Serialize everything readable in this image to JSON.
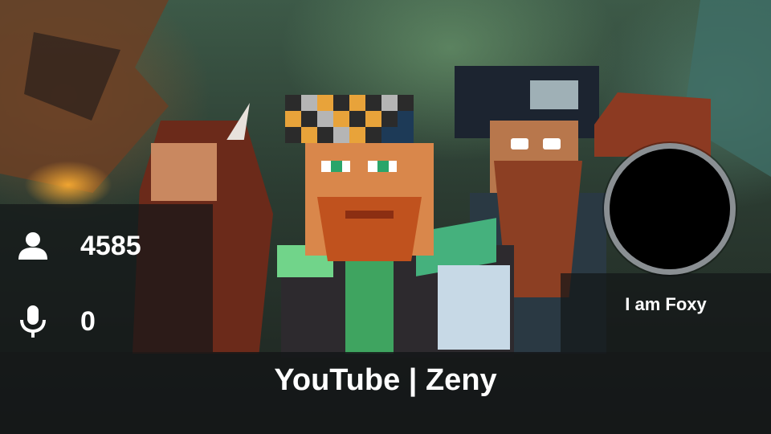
{
  "stats": {
    "viewers": {
      "icon": "person-icon",
      "value": "4585"
    },
    "speakers": {
      "icon": "microphone-icon",
      "value": "0"
    }
  },
  "profile": {
    "name": "I am Foxy"
  },
  "footer": {
    "title": "YouTube | Zeny"
  },
  "colors": {
    "overlay": "#141618",
    "text": "#ffffff",
    "avatar_ring": "#8a8f93"
  }
}
